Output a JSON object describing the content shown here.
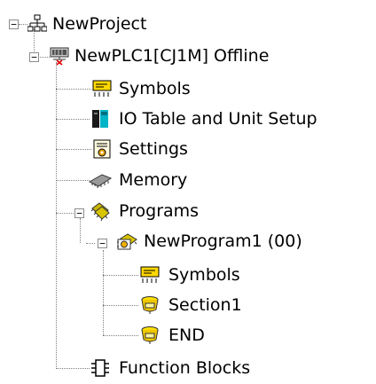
{
  "tree": {
    "root": {
      "label": "NewProject",
      "icon": "network-icon",
      "expanded": true
    },
    "plc": {
      "label": "NewPLC1[CJ1M] Offline",
      "icon": "plc-offline-icon",
      "expanded": true
    },
    "plc_children": [
      {
        "label": "Symbols",
        "icon": "symbols-icon"
      },
      {
        "label": "IO Table and Unit Setup",
        "icon": "io-table-icon"
      },
      {
        "label": "Settings",
        "icon": "settings-icon"
      },
      {
        "label": "Memory",
        "icon": "memory-icon"
      }
    ],
    "programs": {
      "label": "Programs",
      "icon": "programs-icon",
      "expanded": true
    },
    "program1": {
      "label": "NewProgram1 (00)",
      "icon": "program-icon",
      "expanded": true
    },
    "program_children": [
      {
        "label": "Symbols",
        "icon": "symbols-icon"
      },
      {
        "label": "Section1",
        "icon": "section-icon"
      },
      {
        "label": "END",
        "icon": "section-end-icon"
      }
    ],
    "function_blocks": {
      "label": "Function Blocks",
      "icon": "function-blocks-icon"
    }
  }
}
